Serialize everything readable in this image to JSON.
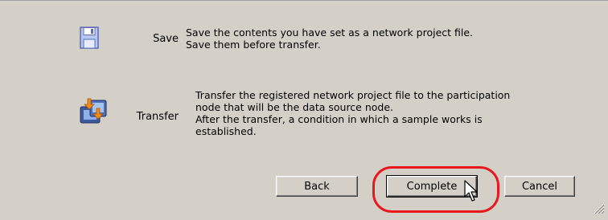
{
  "items": [
    {
      "label": "Save",
      "icon": "floppy-disk-icon",
      "lines": [
        "Save the contents you have set as a network project file.",
        "Save them before transfer."
      ]
    },
    {
      "label": "Transfer",
      "icon": "transfer-icon",
      "lines": [
        "Transfer the registered network project file to the participation",
        "node that will be the data source node.",
        "After the transfer, a condition in which a sample works is",
        "established."
      ]
    }
  ],
  "buttons": {
    "back": "Back",
    "complete": "Complete",
    "cancel": "Cancel"
  },
  "colors": {
    "dialog_bg": "#d4d0c8",
    "highlight": "#e8191d"
  }
}
